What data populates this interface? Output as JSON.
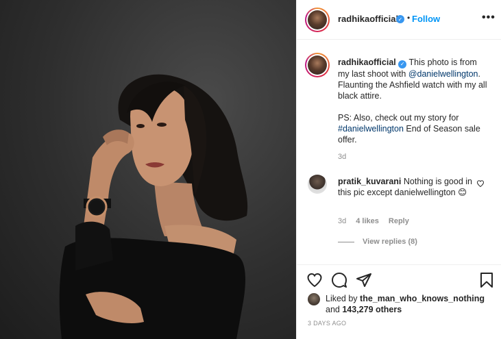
{
  "post": {
    "author": "radhikaofficial",
    "follow_label": "Follow",
    "dot": "•",
    "more_label": "•••"
  },
  "caption": {
    "author": "radhikaofficial",
    "text_1": "This photo is from my last shoot with ",
    "mention": "@danielwellington",
    "text_2": ". Flaunting the Ashfield watch with my all black attire.",
    "text_3": "PS: Also, check out my story for ",
    "hashtag": "#danielwellington",
    "text_4": " End of Season sale offer.",
    "time": "3d"
  },
  "comment": {
    "author": "pratik_kuvarani",
    "text": "Nothing is good in this pic except danielwellington",
    "emoji": "😊",
    "time": "3d",
    "likes": "4 likes",
    "reply_label": "Reply",
    "view_replies": "View replies (8)"
  },
  "likes": {
    "prefix": "Liked by ",
    "user": "the_man_who_knows_nothing",
    "and": "and ",
    "count": "143,279 others"
  },
  "timestamp": "3 DAYS AGO",
  "icons": {
    "verified": "verified-badge-icon",
    "heart": "heart-icon",
    "comment": "comment-icon",
    "share": "paper-plane-icon",
    "save": "bookmark-icon"
  },
  "colors": {
    "accent": "#0095f6",
    "verified": "#3897f0",
    "link": "#00376b",
    "muted": "#8e8e8e"
  }
}
